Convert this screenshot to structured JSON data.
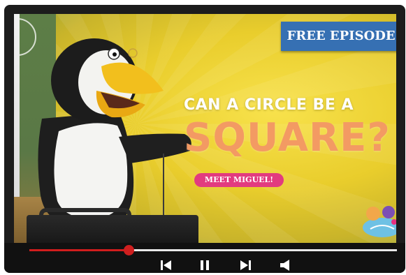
{
  "badge": {
    "label": "FREE EPISODE!"
  },
  "headline": {
    "line1": "CAN A CIRCLE BE A",
    "line2": "SQUARE?"
  },
  "pill": {
    "label": "MEET MIGUEL!"
  },
  "colors": {
    "badge_bg": "#3670b3",
    "headline_accent": "#f39a63",
    "pill_bg": "#e23b7f",
    "progress_played": "#d11d1d",
    "progress_track": "#e9e9e9"
  },
  "playback": {
    "progress_fraction": 0.27
  },
  "controls": {
    "icons": [
      "skip-back-icon",
      "pause-icon",
      "skip-forward-icon",
      "volume-icon"
    ]
  }
}
